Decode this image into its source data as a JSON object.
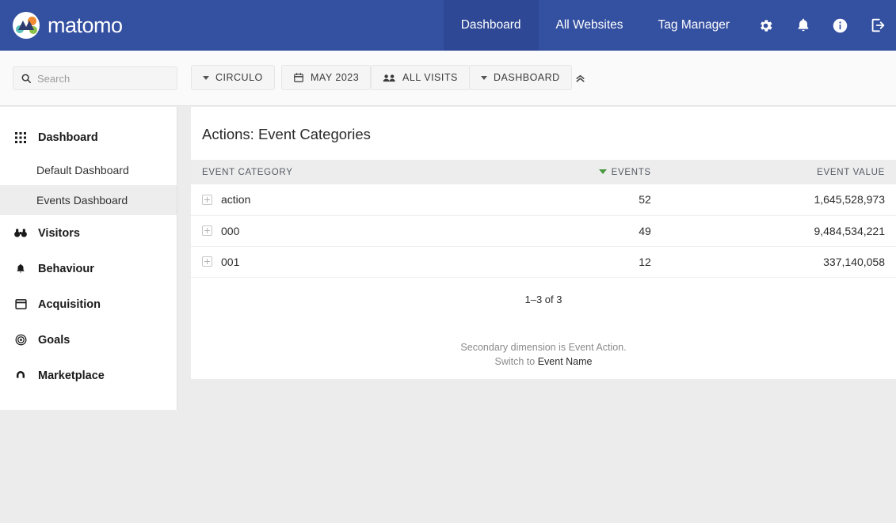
{
  "brand": {
    "name": "matomo",
    "logo_icon": "matomo-logo-icon"
  },
  "topnav": {
    "links": [
      {
        "label": "Dashboard",
        "active": true
      },
      {
        "label": "All Websites",
        "active": false
      },
      {
        "label": "Tag Manager",
        "active": false
      }
    ],
    "icons": [
      {
        "name": "gear-icon"
      },
      {
        "name": "bell-icon"
      },
      {
        "name": "info-icon"
      },
      {
        "name": "logout-icon"
      }
    ]
  },
  "filterbar": {
    "search": {
      "placeholder": "Search",
      "value": "",
      "icon": "search-icon"
    },
    "site_selector": {
      "label": "CIRCULO",
      "icon": "caret-down-icon"
    },
    "date_selector": {
      "label": "MAY 2023",
      "icon": "calendar-icon"
    },
    "segment_selector": {
      "label": "ALL VISITS",
      "icon": "users-icon"
    },
    "widget_selector": {
      "label": "DASHBOARD",
      "icon": "caret-down-icon"
    },
    "collapse_button": {
      "icon": "double-chevron-up-icon"
    }
  },
  "sidebar": {
    "items": [
      {
        "label": "Dashboard",
        "icon": "grid-icon",
        "type": "section",
        "selected": false
      },
      {
        "label": "Default Dashboard",
        "icon": "",
        "type": "sub",
        "selected": false
      },
      {
        "label": "Events Dashboard",
        "icon": "",
        "type": "sub",
        "selected": true
      },
      {
        "label": "Visitors",
        "icon": "binoculars-icon",
        "type": "section",
        "selected": false
      },
      {
        "label": "Behaviour",
        "icon": "bell-icon",
        "type": "section",
        "selected": false
      },
      {
        "label": "Acquisition",
        "icon": "window-icon",
        "type": "section",
        "selected": false
      },
      {
        "label": "Goals",
        "icon": "target-icon",
        "type": "section",
        "selected": false
      },
      {
        "label": "Marketplace",
        "icon": "marketplace-icon",
        "type": "section",
        "selected": false
      }
    ]
  },
  "panel": {
    "title": "Actions: Event Categories",
    "columns": [
      {
        "label": "EVENT CATEGORY",
        "align": "left",
        "sorted": false
      },
      {
        "label": "EVENTS",
        "align": "right",
        "sorted": true,
        "sort_direction": "desc"
      },
      {
        "label": "EVENT VALUE",
        "align": "right",
        "sorted": false
      }
    ],
    "rows": [
      {
        "category": "action",
        "events": "52",
        "event_value": "1,645,528,973",
        "expand_icon": "plus-square-icon"
      },
      {
        "category": "000",
        "events": "49",
        "event_value": "9,484,534,221",
        "expand_icon": "plus-square-icon"
      },
      {
        "category": "001",
        "events": "12",
        "event_value": "337,140,058",
        "expand_icon": "plus-square-icon"
      }
    ],
    "pager": "1–3 of 3",
    "footnote_line1": "Secondary dimension is Event Action.",
    "footnote_switch_prefix": "Switch to ",
    "footnote_switch_link": "Event Name"
  },
  "colors": {
    "header_blue": "#3450a1",
    "header_blue_active": "#2e4896",
    "page_background": "#ececed",
    "sort_green": "#4b9a43",
    "panel_white": "#ffffff",
    "table_header_gray": "#ededee"
  }
}
